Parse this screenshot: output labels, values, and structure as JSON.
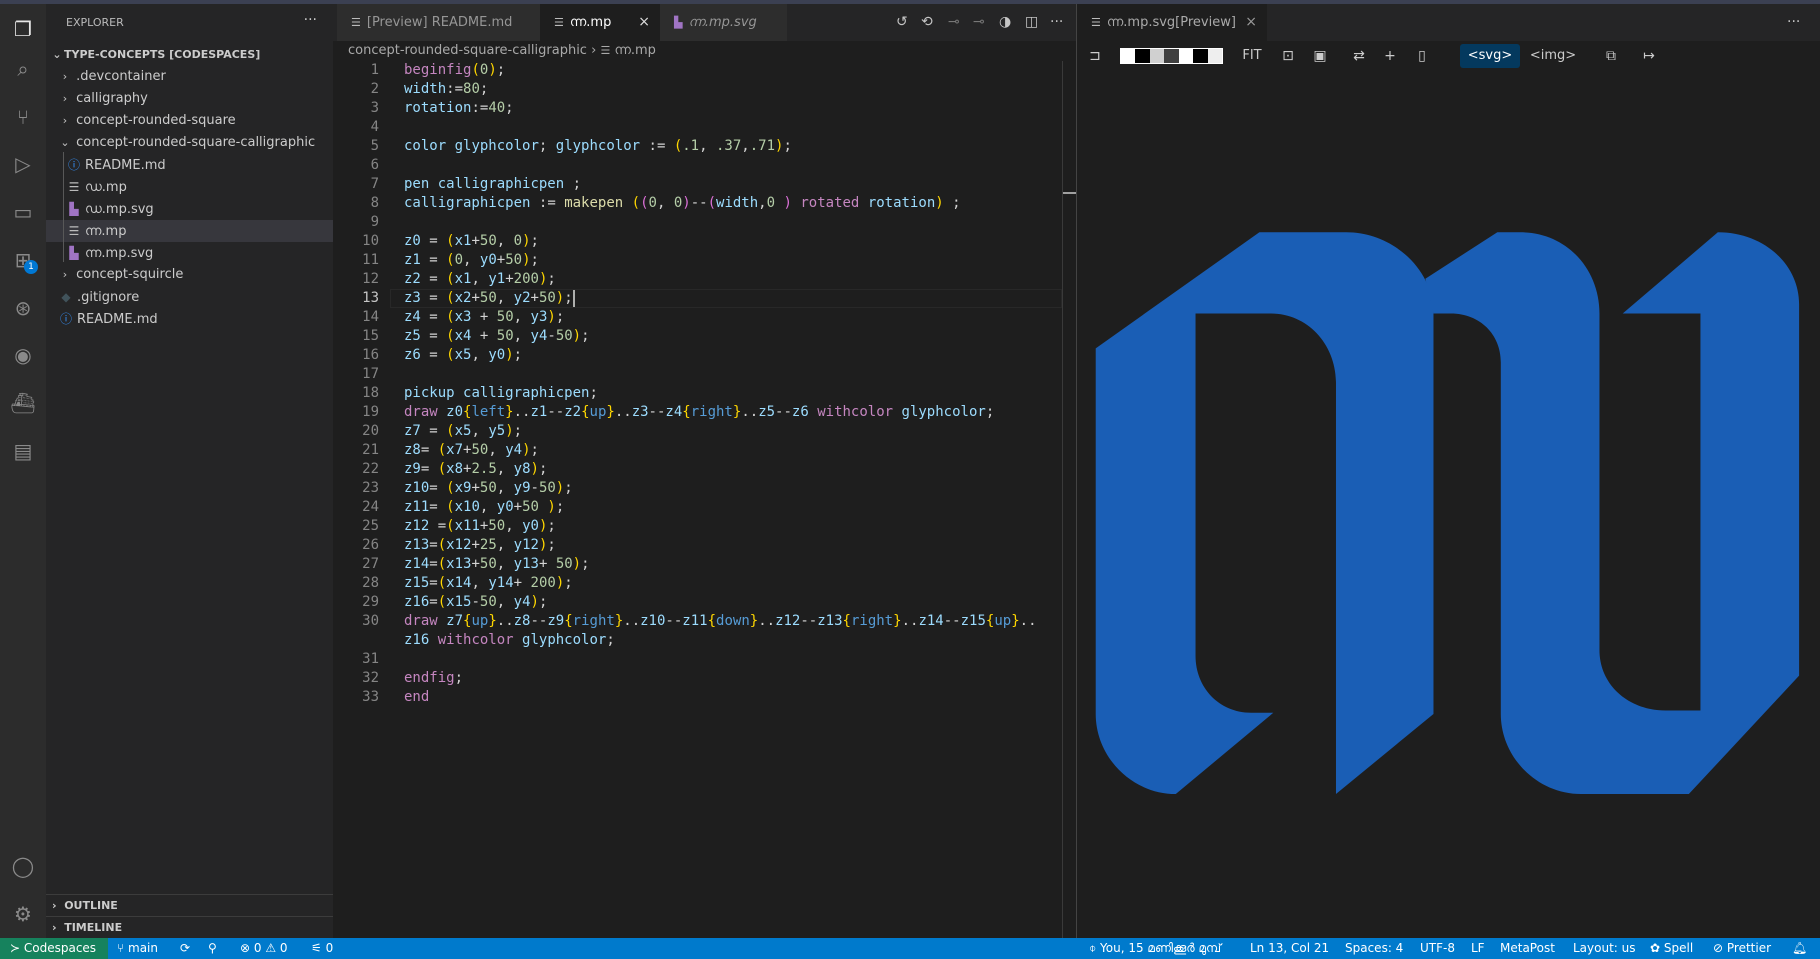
{
  "activity_bar": {
    "items": [
      {
        "name": "explorer-icon",
        "glyph": "❐",
        "active": true
      },
      {
        "name": "search-icon",
        "glyph": "⌕"
      },
      {
        "name": "source-control-icon",
        "glyph": "⑂"
      },
      {
        "name": "run-debug-icon",
        "glyph": "▷"
      },
      {
        "name": "remote-explorer-icon",
        "glyph": "▭"
      },
      {
        "name": "extensions-icon",
        "glyph": "⊞",
        "badge": "1"
      },
      {
        "name": "git-graph-icon",
        "glyph": "⊛"
      },
      {
        "name": "github-icon",
        "glyph": "◉"
      },
      {
        "name": "docker-icon",
        "glyph": "⛴"
      },
      {
        "name": "notebook-icon",
        "glyph": "▤"
      }
    ],
    "bottom": [
      {
        "name": "accounts-icon",
        "glyph": "◯"
      },
      {
        "name": "settings-gear-icon",
        "glyph": "⚙"
      }
    ]
  },
  "sidebar": {
    "title": "EXPLORER",
    "more": "···",
    "root": "TYPE-CONCEPTS [CODESPACES]",
    "items": [
      {
        "label": ".devcontainer",
        "type": "folder",
        "expanded": false
      },
      {
        "label": "calligraphy",
        "type": "folder",
        "expanded": false
      },
      {
        "label": "concept-rounded-square",
        "type": "folder",
        "expanded": false
      },
      {
        "label": "concept-rounded-square-calligraphic",
        "type": "folder",
        "expanded": true
      },
      {
        "label": "README.md",
        "type": "info"
      },
      {
        "label": "ഡ.mp",
        "type": "text"
      },
      {
        "label": "ഡ.mp.svg",
        "type": "svg"
      },
      {
        "label": "ന്ന.mp",
        "type": "text",
        "selected": true
      },
      {
        "label": "ന്ന.mp.svg",
        "type": "svg"
      },
      {
        "label": "concept-squircle",
        "type": "folder",
        "expanded": false
      },
      {
        "label": ".gitignore",
        "type": "git"
      },
      {
        "label": "README.md",
        "type": "info"
      }
    ],
    "outline": "OUTLINE",
    "timeline": "TIMELINE"
  },
  "editor": {
    "tabs": [
      {
        "label": "[Preview] README.md"
      },
      {
        "label": "ന്ന.mp",
        "active": true,
        "close": "×"
      },
      {
        "label": "ന്ന.mp.svg",
        "italic": true
      }
    ],
    "actions": [
      "timeline-history-icon",
      "revert-icon",
      "previous-change-icon",
      "next-change-icon",
      "compare-icon",
      "split-editor-icon",
      "more-actions-icon"
    ],
    "breadcrumb": [
      "concept-rounded-square-calligraphic",
      "ന്ന.mp"
    ],
    "breadcrumb_sep": "›",
    "current_line": 13,
    "lines": [
      {
        "n": "1",
        "text": "beginfig(0);"
      },
      {
        "n": "2",
        "text": "width:=80;"
      },
      {
        "n": "3",
        "text": "rotation:=40;"
      },
      {
        "n": "4",
        "text": ""
      },
      {
        "n": "5",
        "text": "color glyphcolor; glyphcolor := (.1, .37,.71);"
      },
      {
        "n": "6",
        "text": ""
      },
      {
        "n": "7",
        "text": "pen calligraphicpen ;"
      },
      {
        "n": "8",
        "text": "calligraphicpen := makepen ((0, 0)--(width,0 ) rotated rotation) ;"
      },
      {
        "n": "9",
        "text": ""
      },
      {
        "n": "10",
        "text": "z0 = (x1+50, 0);"
      },
      {
        "n": "11",
        "text": "z1 = (0, y0+50);"
      },
      {
        "n": "12",
        "text": "z2 = (x1, y1+200);"
      },
      {
        "n": "13",
        "text": "z3 = (x2+50, y2+50);"
      },
      {
        "n": "14",
        "text": "z4 = (x3 + 50, y3);"
      },
      {
        "n": "15",
        "text": "z5 = (x4 + 50, y4-50);"
      },
      {
        "n": "16",
        "text": "z6 = (x5, y0);"
      },
      {
        "n": "17",
        "text": ""
      },
      {
        "n": "18",
        "text": "pickup calligraphicpen;"
      },
      {
        "n": "19",
        "text": "draw z0{left}..z1--z2{up}..z3--z4{right}..z5--z6 withcolor glyphcolor;"
      },
      {
        "n": "20",
        "text": "z7 = (x5, y5);"
      },
      {
        "n": "21",
        "text": "z8= (x7+50, y4);"
      },
      {
        "n": "22",
        "text": "z9= (x8+2.5, y8);"
      },
      {
        "n": "23",
        "text": "z10= (x9+50, y9-50);"
      },
      {
        "n": "24",
        "text": "z11= (x10, y0+50 );"
      },
      {
        "n": "25",
        "text": "z12 =(x11+50, y0);"
      },
      {
        "n": "26",
        "text": "z13=(x12+25, y12);"
      },
      {
        "n": "27",
        "text": "z14=(x13+50, y13+ 50);"
      },
      {
        "n": "28",
        "text": "z15=(x14, y14+ 200);"
      },
      {
        "n": "29",
        "text": "z16=(x15-50, y4);"
      },
      {
        "n": "30",
        "text": "draw z7{up}..z8--z9{right}..z10--z11{down}..z12--z13{right}..z14--z15{up}.."
      },
      {
        "n": "",
        "text": "z16 withcolor glyphcolor;"
      },
      {
        "n": "31",
        "text": ""
      },
      {
        "n": "32",
        "text": "endfig;"
      },
      {
        "n": "33",
        "text": "end"
      }
    ]
  },
  "preview": {
    "tab": "ന്ന.mp.svg[Preview]",
    "close": "×",
    "more": "···",
    "toolbar": {
      "fit": "FIT",
      "svg": "<svg>",
      "img": "<img>",
      "svg_active": true,
      "icons": [
        "pin-icon",
        "zoom-fit-icon",
        "zoom-full-icon",
        "swap-icon",
        "add-icon",
        "ruler-icon",
        "copy-icon",
        "export-icon"
      ],
      "swatches": [
        "#ffffff",
        "#000000",
        "#d0d0d0",
        "#404040",
        "#ffffff",
        "#000000",
        "#eeeeee"
      ]
    },
    "glyph_color": "#1a5eb5"
  },
  "status": {
    "remote": "Codespaces",
    "branch": "main",
    "errors": "0",
    "warnings": "0",
    "ports": "0",
    "blame": "You, 15 മണിക്കൂർ മുമ്പ്",
    "position": "Ln 13, Col 21",
    "spaces": "Spaces: 4",
    "encoding": "UTF-8",
    "eol": "LF",
    "language": "MetaPost",
    "layout": "Layout: us",
    "spell": "Spell",
    "prettier": "Prettier"
  },
  "colors": {
    "status_bar": "#007acc",
    "remote": "#16825d",
    "accent": "#0078d4"
  }
}
